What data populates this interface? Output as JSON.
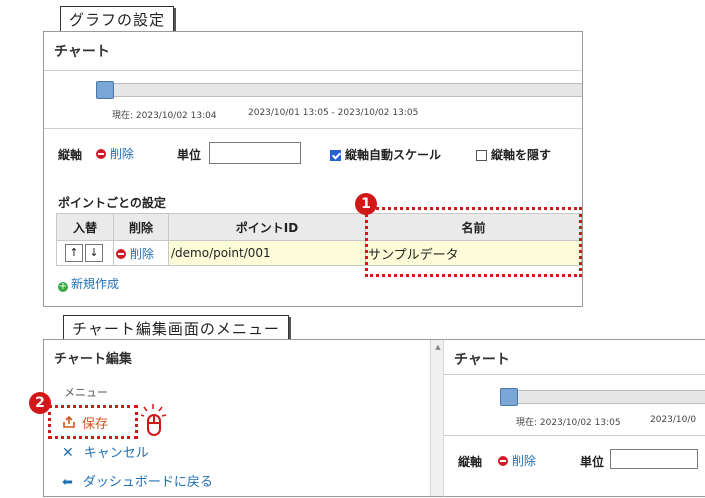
{
  "callouts": {
    "graph_settings": "グラフの設定",
    "chart_edit_menu": "チャート編集画面のメニュー"
  },
  "top_panel": {
    "title": "チャート",
    "slider": {
      "current_label": "現在: 2023/10/02 13:04",
      "range_label": "2023/10/01 13:05 - 2023/10/02 13:05"
    },
    "axis": {
      "label": "縦軸",
      "delete_label": "削除",
      "unit_label": "単位",
      "unit_value": "",
      "autoscale_label": "縦軸自動スケール",
      "autoscale_checked": true,
      "hide_label": "縦軸を隠す",
      "hide_checked": false
    },
    "point_settings": {
      "heading": "ポイントごとの設定",
      "columns": [
        "入替",
        "削除",
        "ポイントID",
        "名前"
      ],
      "rows": [
        {
          "up": "↑",
          "down": "↓",
          "delete": "削除",
          "point_id": "/demo/point/001",
          "name": "サンプルデータ"
        }
      ],
      "new_label": "新規作成"
    },
    "marker": "1"
  },
  "bottom_left": {
    "title": "チャート編集",
    "menu_heading": "メニュー",
    "save_label": "保存",
    "cancel_label": "キャンセル",
    "back_label": "ダッシュボードに戻る",
    "marker": "2",
    "colors": {
      "save": "#d4531b",
      "menu": "#1f6fb5"
    }
  },
  "bottom_right": {
    "title": "チャート",
    "current_label": "現在: 2023/10/02 13:05",
    "range_label": "2023/10/0",
    "axis_label": "縦軸",
    "delete_label": "削除",
    "unit_label": "単位"
  },
  "colors": {
    "accent_red": "#d11818",
    "link_blue": "#1f6fb5",
    "row_highlight": "#fdfcd8"
  }
}
